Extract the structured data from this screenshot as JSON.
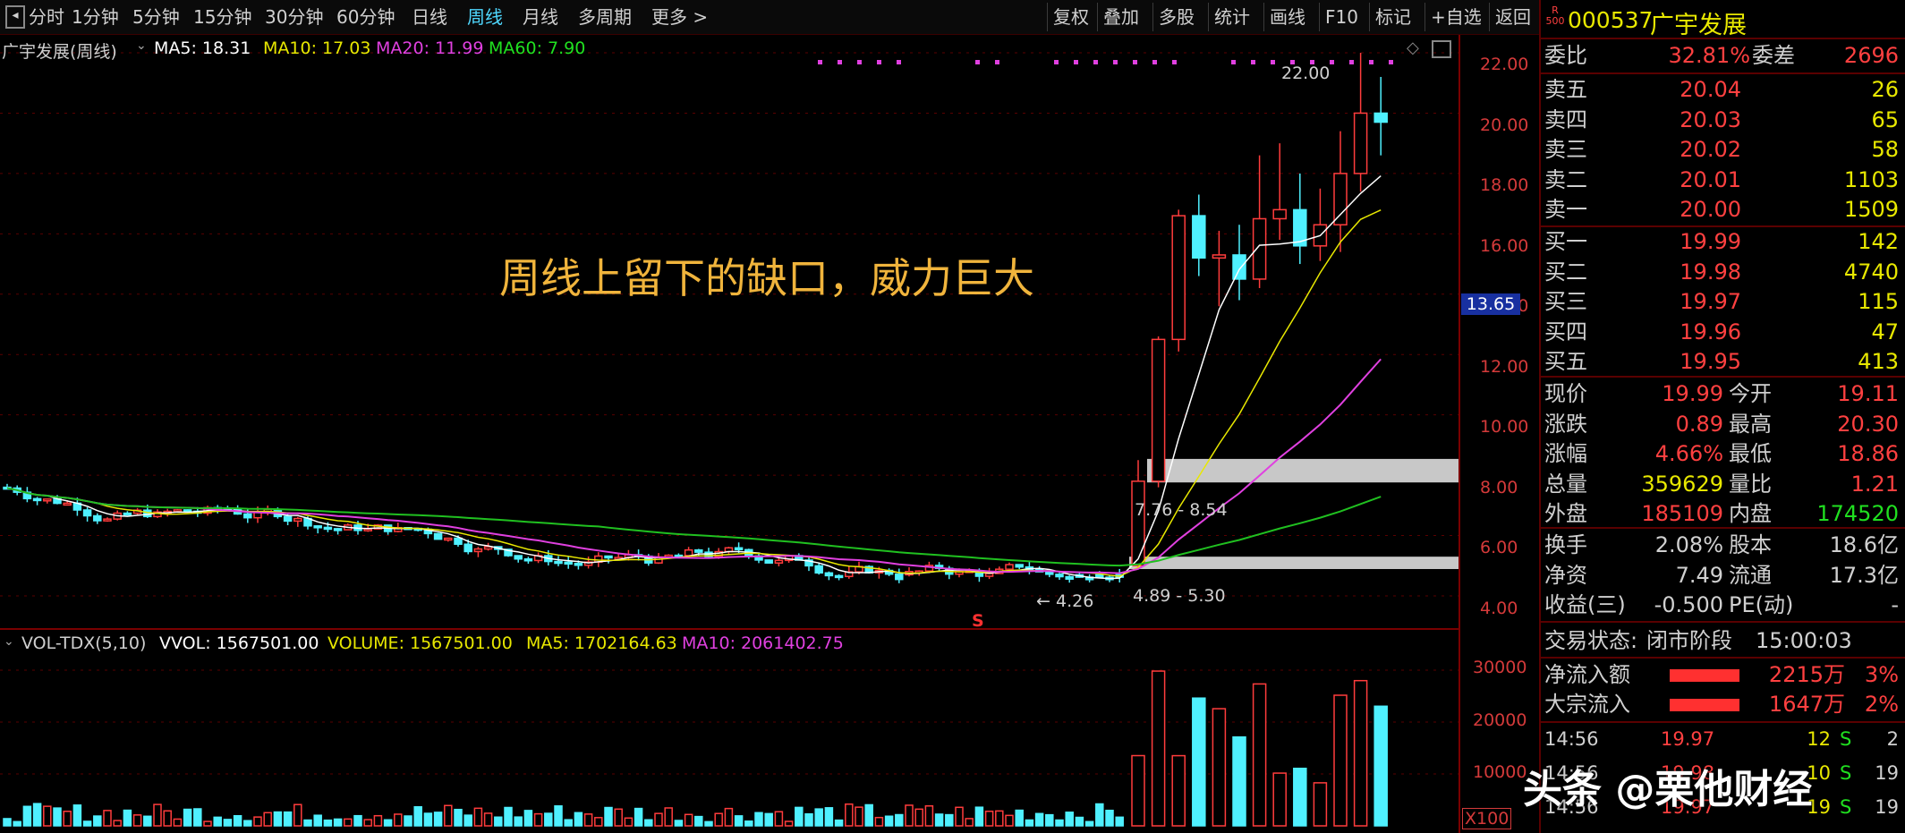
{
  "toolbar": {
    "periods": [
      "分时",
      "1分钟",
      "5分钟",
      "15分钟",
      "30分钟",
      "60分钟",
      "日线",
      "周线",
      "月线",
      "多周期",
      "更多 >"
    ],
    "active": "周线",
    "buttons": [
      "复权",
      "叠加",
      "多股",
      "统计",
      "画线",
      "F10",
      "标记",
      "+自选",
      "返回"
    ]
  },
  "chart": {
    "title": "广宇发展(周线)",
    "ma5": "MA5: 18.31",
    "ma10": "MA10: 17.03",
    "ma20": "MA20: 11.99",
    "ma60": "MA60: 7.90",
    "annotation": "周线上留下的缺口，威力巨大",
    "high_label": "22.00",
    "low_label": "4.26",
    "gap1_label": "7.76 - 8.54",
    "gap2_label": "4.89 - 5.30",
    "current_price_tag": "13.65",
    "s_marker": "S",
    "price_axis": [
      "22.00",
      "20.00",
      "18.00",
      "16.00",
      "14.00",
      "12.00",
      "10.00",
      "8.00",
      "6.00",
      "4.00"
    ],
    "colors": {
      "up": "#ff3c3c",
      "down": "#4ff0ff",
      "ma5": "#ffffff",
      "ma10": "#e8e800",
      "ma20": "#e040e0",
      "ma60": "#20c020"
    }
  },
  "volume": {
    "title": "VOL-TDX(5,10)",
    "vvol": "VVOL: 1567501.00",
    "volume": "VOLUME: 1567501.00",
    "ma5": "MA5: 1702164.63",
    "ma10": "MA10: 2061402.75",
    "axis": [
      "30000",
      "20000",
      "10000"
    ],
    "scale": "X100"
  },
  "quote": {
    "code": "000537",
    "name": "广宇发展",
    "r_tag": "R",
    "r_num": "500",
    "webi_label": "委比",
    "webi": "32.81%",
    "wecha_label": "委差",
    "wecha": "2696",
    "asks": [
      {
        "label": "卖五",
        "price": "20.04",
        "qty": "26"
      },
      {
        "label": "卖四",
        "price": "20.03",
        "qty": "65"
      },
      {
        "label": "卖三",
        "price": "20.02",
        "qty": "58"
      },
      {
        "label": "卖二",
        "price": "20.01",
        "qty": "1103"
      },
      {
        "label": "卖一",
        "price": "20.00",
        "qty": "1509"
      }
    ],
    "bids": [
      {
        "label": "买一",
        "price": "19.99",
        "qty": "142"
      },
      {
        "label": "买二",
        "price": "19.98",
        "qty": "4740"
      },
      {
        "label": "买三",
        "price": "19.97",
        "qty": "115"
      },
      {
        "label": "买四",
        "price": "19.96",
        "qty": "47"
      },
      {
        "label": "买五",
        "price": "19.95",
        "qty": "413"
      }
    ],
    "stats": [
      {
        "k1": "现价",
        "v1": "19.99",
        "k2": "今开",
        "v2": "19.11",
        "c1": "#ff4040",
        "c2": "#ff4040"
      },
      {
        "k1": "涨跌",
        "v1": "0.89",
        "k2": "最高",
        "v2": "20.30",
        "c1": "#ff4040",
        "c2": "#ff4040"
      },
      {
        "k1": "涨幅",
        "v1": "4.66%",
        "k2": "最低",
        "v2": "18.86",
        "c1": "#ff4040",
        "c2": "#ff4040"
      },
      {
        "k1": "总量",
        "v1": "359629",
        "k2": "量比",
        "v2": "1.21",
        "c1": "#e8e800",
        "c2": "#ff4040"
      },
      {
        "k1": "外盘",
        "v1": "185109",
        "k2": "内盘",
        "v2": "174520",
        "c1": "#ff4040",
        "c2": "#20e020"
      }
    ],
    "stats2": [
      {
        "k1": "换手",
        "v1": "2.08%",
        "k2": "股本",
        "v2": "18.6亿"
      },
      {
        "k1": "净资",
        "v1": "7.49",
        "k2": "流通",
        "v2": "17.3亿"
      },
      {
        "k1": "收益(三)",
        "v1": "-0.500",
        "k2": "PE(动)",
        "v2": "-"
      }
    ],
    "trade_status_label": "交易状态:",
    "trade_status": "闭市阶段",
    "trade_time": "15:00:03",
    "flows": [
      {
        "label": "净流入额",
        "value": "2215万",
        "pct": "3%"
      },
      {
        "label": "大宗流入",
        "value": "1647万",
        "pct": "2%"
      }
    ],
    "ticks": [
      {
        "time": "14:56",
        "price": "19.97",
        "vol": "12",
        "side": "S",
        "n": "2"
      },
      {
        "time": "14:56",
        "price": "19.98",
        "vol": "10",
        "side": "S",
        "n": "19"
      },
      {
        "time": "14:56",
        "price": "19.97",
        "vol": "19",
        "side": "S",
        "n": "19"
      }
    ]
  },
  "watermark": "头条 @栗他财经"
}
